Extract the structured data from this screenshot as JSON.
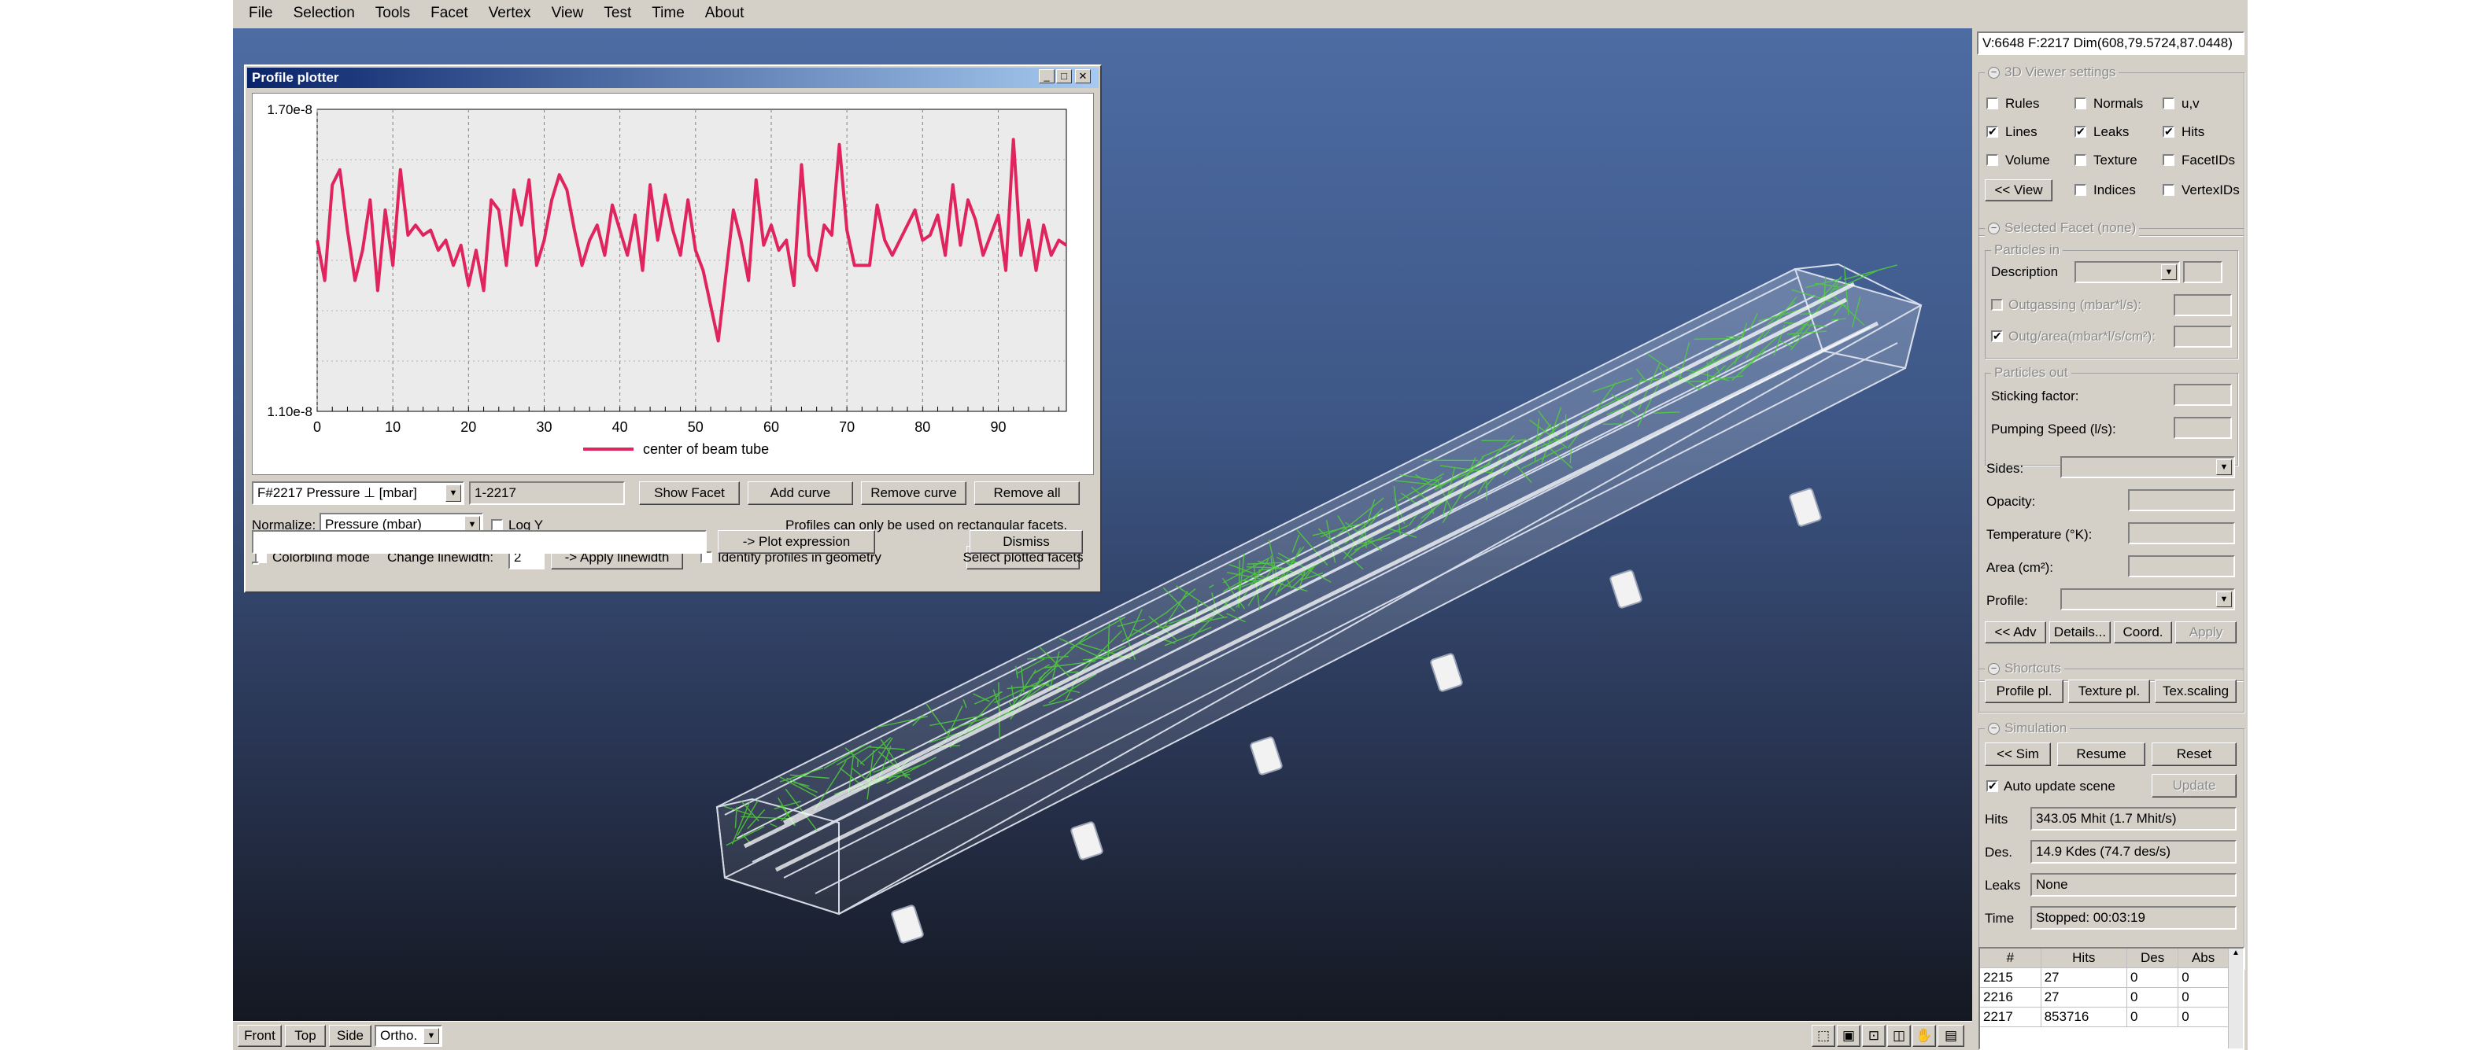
{
  "menu": [
    "File",
    "Selection",
    "Tools",
    "Facet",
    "Vertex",
    "View",
    "Test",
    "Time",
    "About"
  ],
  "stats_header": "V:6648 F:2217 Dim(608,79.5724,87.0448)",
  "viewer_settings": {
    "title": "3D Viewer settings",
    "rules": "Rules",
    "normals": "Normals",
    "uv": "u,v",
    "lines": "Lines",
    "leaks": "Leaks",
    "hits": "Hits",
    "volume": "Volume",
    "texture": "Texture",
    "facet_ids": "FacetIDs",
    "view_button": "<< View",
    "indices": "Indices",
    "vertex_ids": "VertexIDs",
    "checked": {
      "lines": true,
      "leaks": true,
      "hits": true
    }
  },
  "selected_facet": {
    "title": "Selected Facet (none)",
    "particles_in": "Particles in",
    "description": "Description",
    "outgassing": "Outgassing (mbar*l/s):",
    "outg_area": "Outg/area(mbar*l/s/cm²):",
    "particles_out": "Particles out",
    "sticking": "Sticking factor:",
    "pumping": "Pumping Speed (l/s):",
    "sides": "Sides:",
    "opacity": "Opacity:",
    "temperature": "Temperature (°K):",
    "area": "Area (cm²):",
    "profile": "Profile:",
    "adv_button": "<< Adv",
    "details_button": "Details...",
    "coord_button": "Coord.",
    "apply_button": "Apply"
  },
  "shortcuts": {
    "title": "Shortcuts",
    "profile_button": "Profile pl.",
    "texture_button": "Texture pl.",
    "texscaling_button": "Tex.scaling"
  },
  "simulation": {
    "title": "Simulation",
    "sim_button": "<< Sim",
    "resume_button": "Resume",
    "reset_button": "Reset",
    "auto_update": "Auto update scene",
    "update_button": "Update",
    "hits_label": "Hits",
    "hits_value": "343.05 Mhit (1.7 Mhit/s)",
    "des_label": "Des.",
    "des_value": "14.9 Kdes (74.7 des/s)",
    "leaks_label": "Leaks",
    "leaks_value": "None",
    "time_label": "Time",
    "time_value": "Stopped: 00:03:19"
  },
  "facet_table": {
    "headers": [
      "#",
      "Hits",
      "Des",
      "Abs"
    ],
    "rows": [
      [
        "2215",
        "27",
        "0",
        "0"
      ],
      [
        "2216",
        "27",
        "0",
        "0"
      ],
      [
        "2217",
        "853716",
        "0",
        "0"
      ]
    ]
  },
  "bottom_toolbar": {
    "front": "Front",
    "top": "Top",
    "side": "Side",
    "ortho": "Ortho."
  },
  "plotter": {
    "window_title": "Profile plotter",
    "profile_select": "F#2217 Pressure ⊥ [mbar]",
    "facet_range": "1-2217",
    "show_facet": "Show Facet",
    "add_curve": "Add curve",
    "remove_curve": "Remove curve",
    "remove_all": "Remove all",
    "normalize_label": "Normalize:",
    "normalize_value": "Pressure (mbar)",
    "log_y": "Log Y",
    "note": "Profiles can only be used on rectangular facets.",
    "colorblind": "Colorblind mode",
    "linewidth_label": "Change linewidth:",
    "linewidth_value": "2",
    "apply_linewidth": "-> Apply linewidth",
    "identify": "Identify profiles in geometry",
    "select_plotted": "Select plotted facets",
    "expression": "",
    "plot_expression": "-> Plot expression",
    "dismiss": "Dismiss"
  },
  "chart_data": {
    "type": "line",
    "title": "",
    "xlabel": "",
    "ylabel": "",
    "ytick_labels": [
      "1.10e-8",
      "1.70e-8"
    ],
    "xticks": [
      0,
      10,
      20,
      30,
      40,
      50,
      60,
      70,
      80,
      90
    ],
    "xlim": [
      0,
      99
    ],
    "ylim": [
      1.1e-08,
      1.7e-08
    ],
    "grid": true,
    "legend_position": "bottom-center",
    "series_color": "#e0245e",
    "series": [
      {
        "name": "center of beam tube",
        "x": [
          0,
          1,
          2,
          3,
          4,
          5,
          6,
          7,
          8,
          9,
          10,
          11,
          12,
          13,
          14,
          15,
          16,
          17,
          18,
          19,
          20,
          21,
          22,
          23,
          24,
          25,
          26,
          27,
          28,
          29,
          30,
          31,
          32,
          33,
          34,
          35,
          36,
          37,
          38,
          39,
          40,
          41,
          42,
          43,
          44,
          45,
          46,
          47,
          48,
          49,
          50,
          51,
          52,
          53,
          54,
          55,
          56,
          57,
          58,
          59,
          60,
          61,
          62,
          63,
          64,
          65,
          66,
          67,
          68,
          69,
          70,
          71,
          72,
          73,
          74,
          75,
          76,
          77,
          78,
          79,
          80,
          81,
          82,
          83,
          84,
          85,
          86,
          87,
          88,
          89,
          90,
          91,
          92,
          93,
          94,
          95,
          96,
          97,
          98,
          99
        ],
        "values": [
          1.44,
          1.36,
          1.55,
          1.58,
          1.46,
          1.36,
          1.42,
          1.52,
          1.34,
          1.5,
          1.39,
          1.58,
          1.45,
          1.47,
          1.45,
          1.46,
          1.42,
          1.44,
          1.39,
          1.43,
          1.35,
          1.42,
          1.34,
          1.52,
          1.5,
          1.39,
          1.54,
          1.47,
          1.56,
          1.39,
          1.44,
          1.52,
          1.57,
          1.54,
          1.46,
          1.39,
          1.44,
          1.47,
          1.41,
          1.51,
          1.46,
          1.41,
          1.49,
          1.38,
          1.55,
          1.44,
          1.53,
          1.46,
          1.41,
          1.52,
          1.42,
          1.38,
          1.31,
          1.24,
          1.37,
          1.5,
          1.44,
          1.36,
          1.56,
          1.43,
          1.47,
          1.42,
          1.44,
          1.35,
          1.59,
          1.41,
          1.38,
          1.47,
          1.45,
          1.63,
          1.46,
          1.39,
          1.39,
          1.39,
          1.51,
          1.44,
          1.41,
          1.44,
          1.47,
          1.5,
          1.44,
          1.45,
          1.49,
          1.41,
          1.55,
          1.43,
          1.52,
          1.48,
          1.41,
          1.45,
          1.49,
          1.38,
          1.64,
          1.41,
          1.48,
          1.38,
          1.47,
          1.41,
          1.44,
          1.43
        ]
      }
    ]
  }
}
